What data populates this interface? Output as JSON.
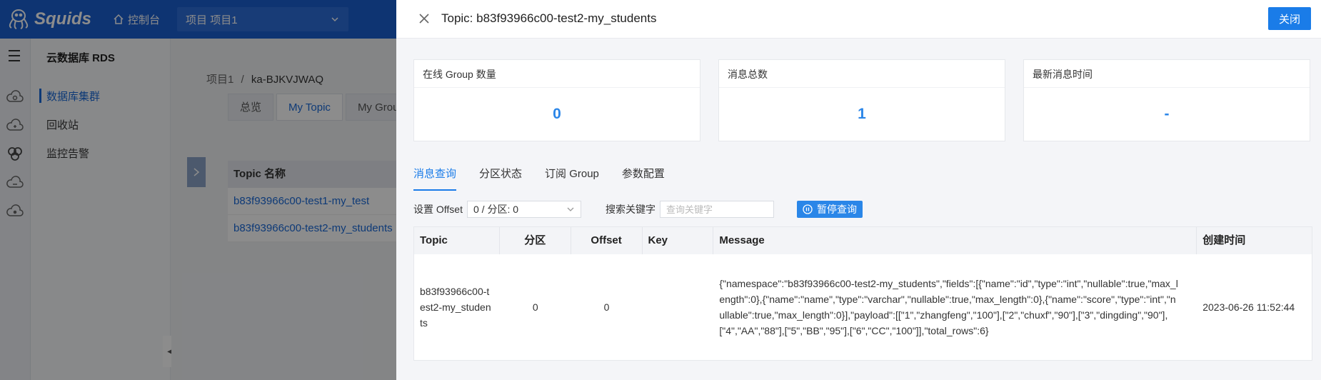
{
  "app": {
    "logo_text": "Squids",
    "console_label": "控制台",
    "project_select": "项目  项目1"
  },
  "sidenav": {
    "title": "云数据库 RDS",
    "items": [
      {
        "label": "数据库集群",
        "active": true
      },
      {
        "label": "回收站",
        "active": false
      },
      {
        "label": "监控告警",
        "active": false
      }
    ]
  },
  "background": {
    "breadcrumb": {
      "root": "项目1",
      "sep": "/",
      "current": "ka-BJKVJWAQ"
    },
    "tabs": [
      "总览",
      "My Topic",
      "My Grou"
    ],
    "table_header": "Topic 名称",
    "rows": [
      "b83f93966c00-test1-my_test",
      "b83f93966c00-test2-my_students"
    ]
  },
  "drawer": {
    "title": "Topic: b83f93966c00-test2-my_students",
    "close_label": "关闭",
    "cards": [
      {
        "label": "在线 Group 数量",
        "value": "0"
      },
      {
        "label": "消息总数",
        "value": "1"
      },
      {
        "label": "最新消息时间",
        "value": "-"
      }
    ],
    "tabs": [
      "消息查询",
      "分区状态",
      "订阅 Group",
      "参数配置"
    ],
    "filter": {
      "offset_label": "设置 Offset",
      "offset_value": "0 / 分区: 0",
      "keyword_label": "搜索关键字",
      "keyword_placeholder": "查询关键字",
      "pause_label": "暂停查询"
    },
    "table": {
      "headers": [
        "Topic",
        "分区",
        "Offset",
        "Key",
        "Message",
        "创建时间"
      ],
      "rows": [
        {
          "topic": "b83f93966c00-test2-my_students",
          "partition": "0",
          "offset": "0",
          "key": "",
          "message": "{\"namespace\":\"b83f93966c00-test2-my_students\",\"fields\":[{\"name\":\"id\",\"type\":\"int\",\"nullable\":true,\"max_length\":0},{\"name\":\"name\",\"type\":\"varchar\",\"nullable\":true,\"max_length\":0},{\"name\":\"score\",\"type\":\"int\",\"nullable\":true,\"max_length\":0}],\"payload\":[[\"1\",\"zhangfeng\",\"100\"],[\"2\",\"chuxf\",\"90\"],[\"3\",\"dingding\",\"90\"],[\"4\",\"AA\",\"88\"],[\"5\",\"BB\",\"95\"],[\"6\",\"CC\",\"100\"]],\"total_rows\":6}",
          "created": "2023-06-26 11:52:44"
        }
      ]
    }
  }
}
